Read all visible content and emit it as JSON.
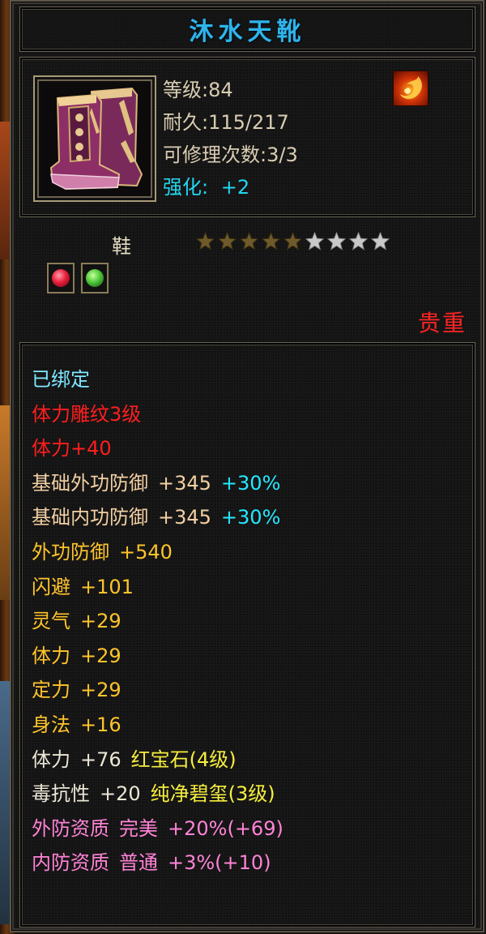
{
  "item": {
    "name": "沐水天靴",
    "level": "等级:84",
    "durability": "耐久:115/217",
    "repairs": "可修理次数:3/3",
    "enhance_label": "强化:",
    "enhance_value": "+2",
    "type": "鞋",
    "stars_total": 9,
    "stars_filled": 5,
    "rarity": "贵重",
    "gems": [
      {
        "icon": "red-gem-icon",
        "color": "#e8203a"
      },
      {
        "icon": "green-gem-icon",
        "color": "#4ec83a"
      }
    ]
  },
  "attributes": [
    {
      "parts": [
        {
          "text": "已绑定",
          "color": "cyan"
        }
      ]
    },
    {
      "parts": [
        {
          "text": "体力雕纹3级",
          "color": "red"
        }
      ]
    },
    {
      "parts": [
        {
          "text": "体力+40",
          "color": "red"
        }
      ]
    },
    {
      "parts": [
        {
          "text": "基础外功防御",
          "color": "tan"
        },
        {
          "text": "+345",
          "color": "tan"
        },
        {
          "text": "+30%",
          "color": "aqua"
        }
      ]
    },
    {
      "parts": [
        {
          "text": "基础内功防御",
          "color": "tan"
        },
        {
          "text": "+345",
          "color": "tan"
        },
        {
          "text": "+30%",
          "color": "aqua"
        }
      ]
    },
    {
      "parts": [
        {
          "text": "外功防御",
          "color": "gold"
        },
        {
          "text": "+540",
          "color": "gold"
        }
      ]
    },
    {
      "parts": [
        {
          "text": "闪避",
          "color": "gold"
        },
        {
          "text": "+101",
          "color": "gold"
        }
      ]
    },
    {
      "parts": [
        {
          "text": "灵气",
          "color": "gold"
        },
        {
          "text": "+29",
          "color": "gold"
        }
      ]
    },
    {
      "parts": [
        {
          "text": "体力",
          "color": "gold"
        },
        {
          "text": "+29",
          "color": "gold"
        }
      ]
    },
    {
      "parts": [
        {
          "text": "定力",
          "color": "gold"
        },
        {
          "text": "+29",
          "color": "gold"
        }
      ]
    },
    {
      "parts": [
        {
          "text": "身法",
          "color": "gold"
        },
        {
          "text": "+16",
          "color": "gold"
        }
      ]
    },
    {
      "parts": [
        {
          "text": "体力",
          "color": "white"
        },
        {
          "text": "+76",
          "color": "white"
        },
        {
          "text": "红宝石(4级)",
          "color": "yellow"
        }
      ]
    },
    {
      "parts": [
        {
          "text": "毒抗性",
          "color": "white"
        },
        {
          "text": "+20",
          "color": "white"
        },
        {
          "text": "纯净碧玺(3级)",
          "color": "yellow"
        }
      ]
    },
    {
      "parts": [
        {
          "text": "外防资质",
          "color": "pink"
        },
        {
          "text": "完美",
          "color": "pink"
        },
        {
          "text": "+20%(+69)",
          "color": "pink"
        }
      ]
    },
    {
      "parts": [
        {
          "text": "内防资质",
          "color": "pink"
        },
        {
          "text": "普通",
          "color": "pink"
        },
        {
          "text": "+3%(+10)",
          "color": "pink"
        }
      ]
    }
  ],
  "colors": {
    "title": "#2fb4ea",
    "star_filled": "#6e5a2a",
    "star_empty": "#c9c9c9",
    "rarity": "#ff2424"
  }
}
